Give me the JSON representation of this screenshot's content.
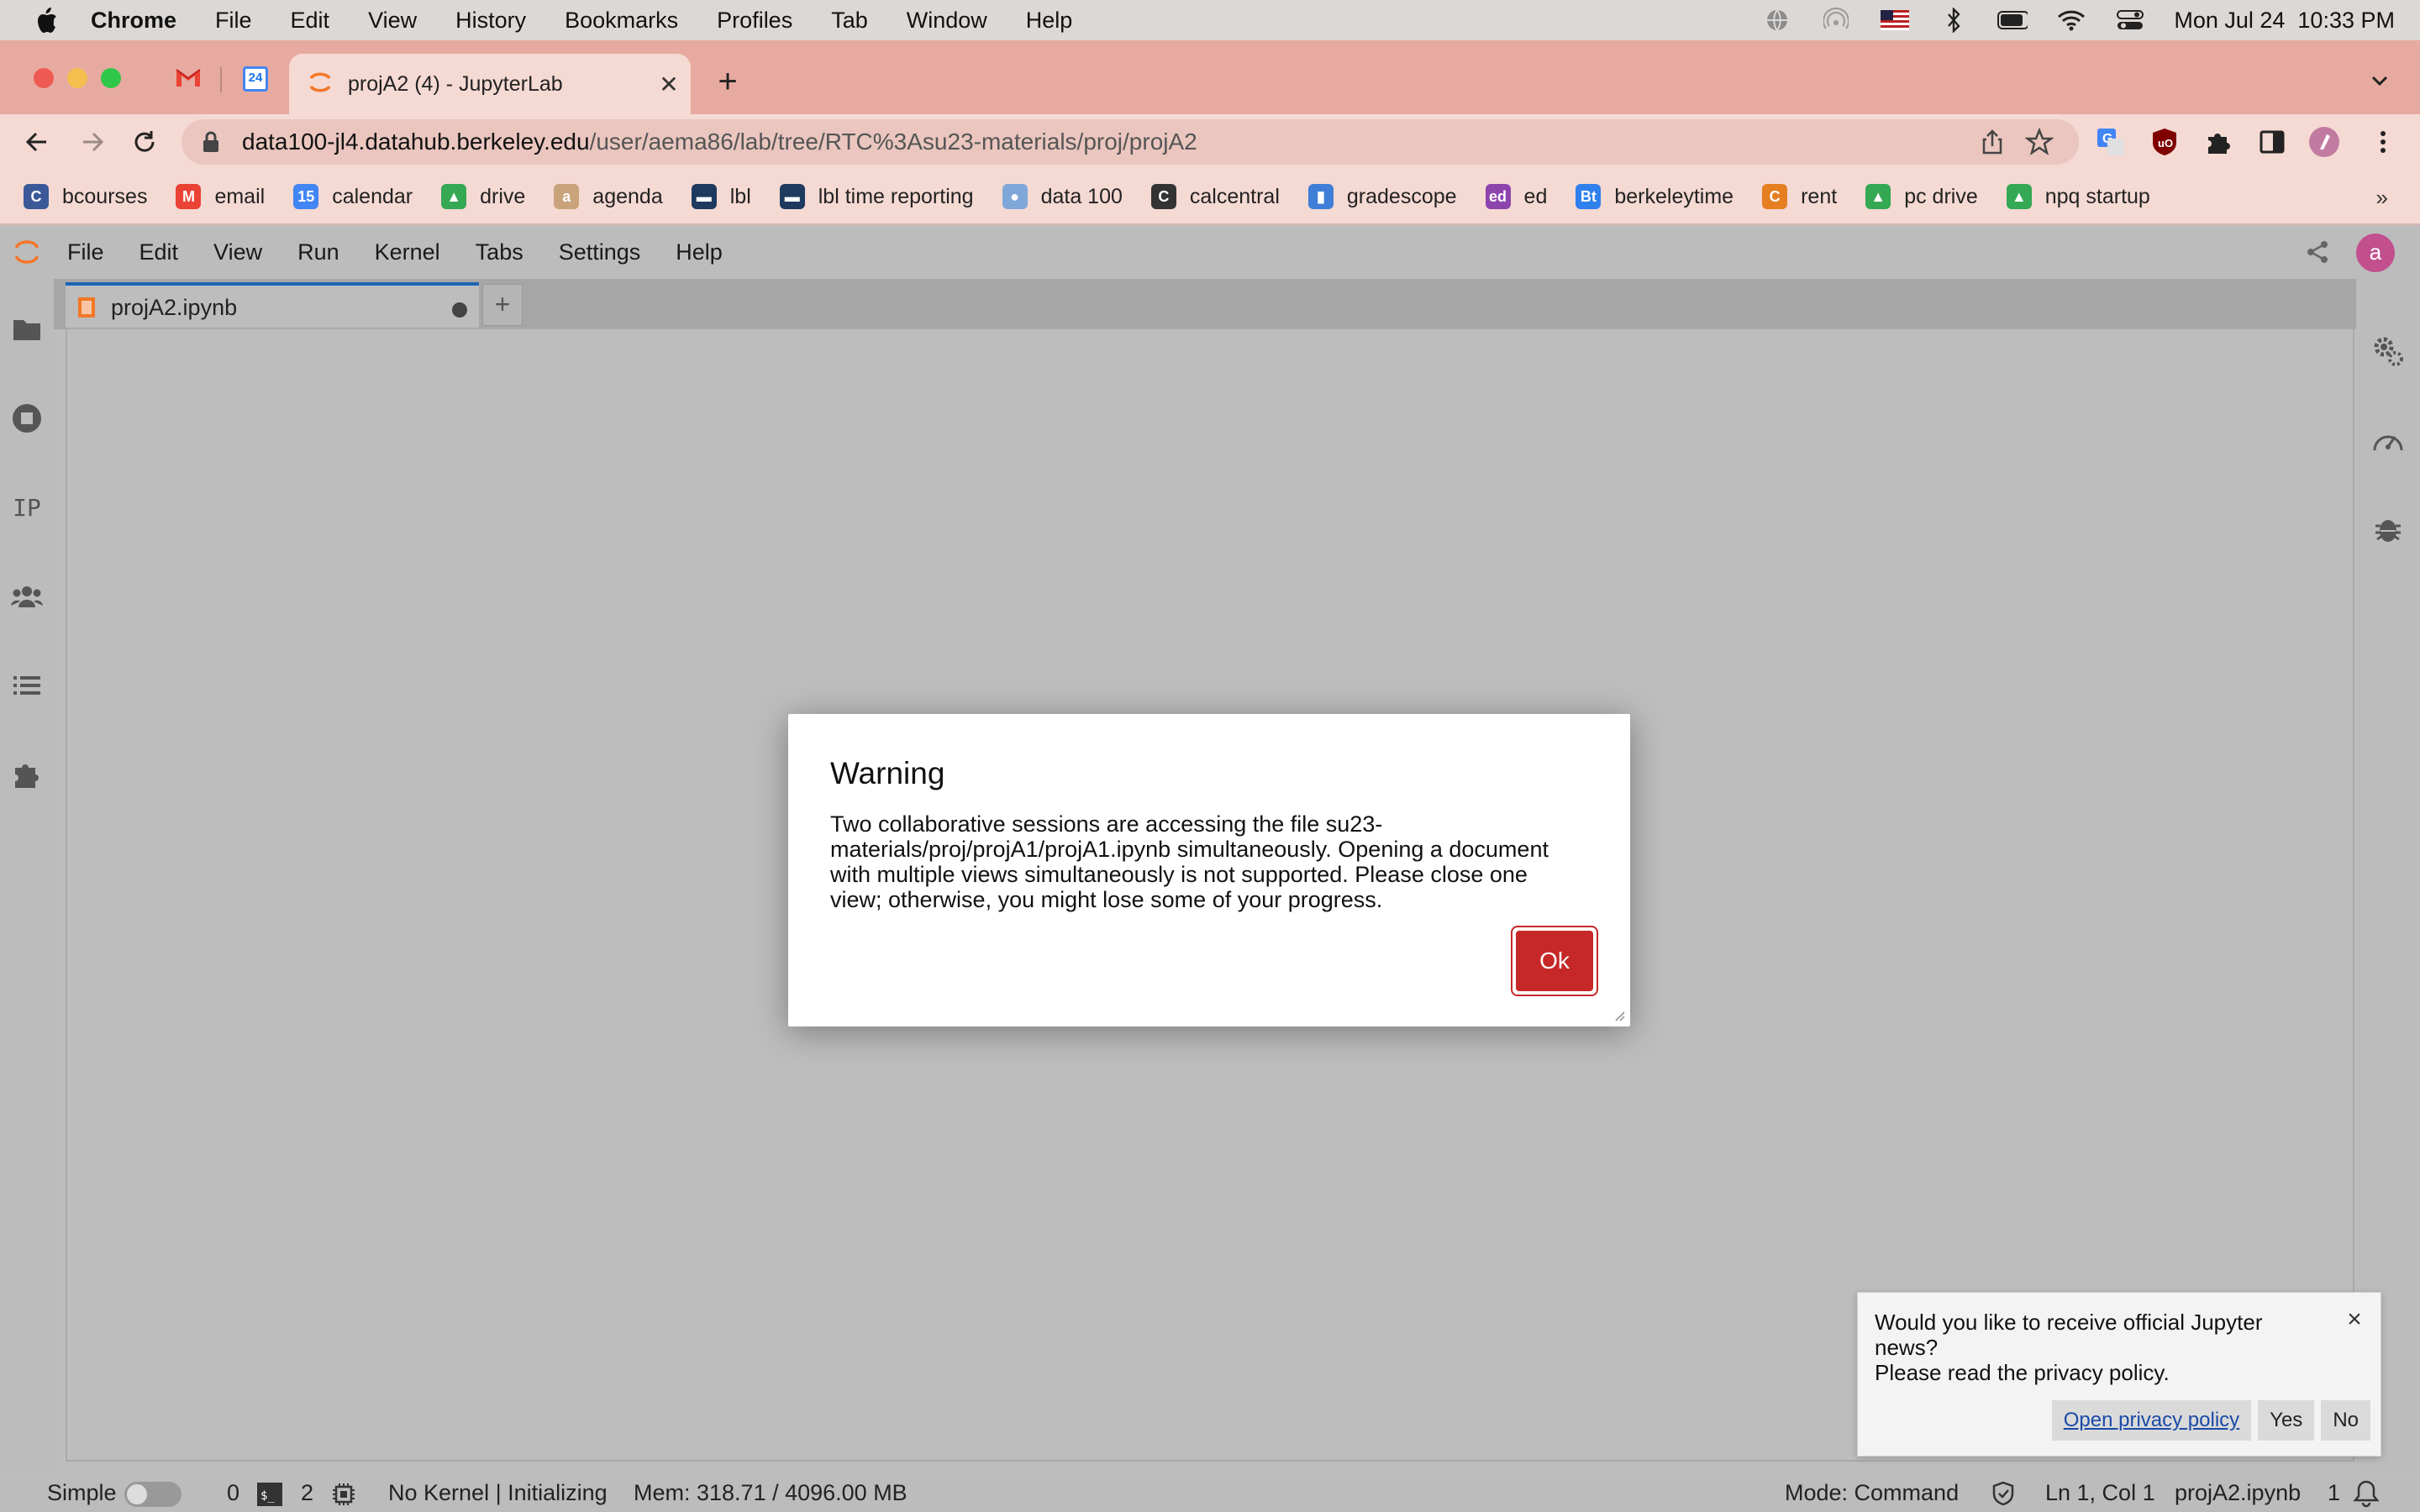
{
  "menubar": {
    "app": "Chrome",
    "items": [
      "File",
      "Edit",
      "View",
      "History",
      "Bookmarks",
      "Profiles",
      "Tab",
      "Window",
      "Help"
    ],
    "datetime": "Mon Jul 24  10:33 PM"
  },
  "browser": {
    "active_tab_title": "projA2 (4) - JupyterLab",
    "pinned_tabs": [
      {
        "icon": "gmail-icon",
        "badge": ""
      },
      {
        "icon": "calendar-icon",
        "badge": "24"
      }
    ],
    "url_host": "data100-jl4.datahub.berkeley.edu",
    "url_path": "/user/aema86/lab/tree/RTC%3Asu23-materials/proj/projA2",
    "bookmarks": [
      {
        "label": "bcourses",
        "icon": "canvas-icon",
        "color": "#3b5998",
        "glyph": "C"
      },
      {
        "label": "email",
        "icon": "gmail-icon",
        "color": "#ea4335",
        "glyph": "M"
      },
      {
        "label": "calendar",
        "icon": "calendar-icon",
        "color": "#4285f4",
        "glyph": "15"
      },
      {
        "label": "drive",
        "icon": "drive-icon",
        "color": "#34a853",
        "glyph": "▲"
      },
      {
        "label": "agenda",
        "icon": "agenda-icon",
        "color": "#c8a37b",
        "glyph": "a"
      },
      {
        "label": "lbl",
        "icon": "lbl-icon",
        "color": "#1f3a5f",
        "glyph": "▬"
      },
      {
        "label": "lbl time reporting",
        "icon": "lbl-icon",
        "color": "#1f3a5f",
        "glyph": "▬"
      },
      {
        "label": "data 100",
        "icon": "data100-icon",
        "color": "#7fa7d8",
        "glyph": "●"
      },
      {
        "label": "calcentral",
        "icon": "calcentral-icon",
        "color": "#333333",
        "glyph": "C"
      },
      {
        "label": "gradescope",
        "icon": "gradescope-icon",
        "color": "#3f7fd8",
        "glyph": "▮"
      },
      {
        "label": "ed",
        "icon": "ed-icon",
        "color": "#8e44ad",
        "glyph": "ed"
      },
      {
        "label": "berkeleytime",
        "icon": "berkeleytime-icon",
        "color": "#2f80ed",
        "glyph": "Bt"
      },
      {
        "label": "rent",
        "icon": "rent-icon",
        "color": "#e67e22",
        "glyph": "C"
      },
      {
        "label": "pc drive",
        "icon": "drive-icon",
        "color": "#34a853",
        "glyph": "▲"
      },
      {
        "label": "npq startup",
        "icon": "drive-icon",
        "color": "#34a853",
        "glyph": "▲"
      }
    ],
    "bookmarks_overflow": "»"
  },
  "jupyter": {
    "menu": [
      "File",
      "Edit",
      "View",
      "Run",
      "Kernel",
      "Tabs",
      "Settings",
      "Help"
    ],
    "user_initial": "a",
    "tab_label": "projA2.ipynb",
    "add_tab": "+",
    "left_sidebar_ip": "IP"
  },
  "dialog": {
    "title": "Warning",
    "body": "Two collaborative sessions are accessing the file su23-materials/proj/projA1/projA1.ipynb simultaneously. Opening a document with multiple views simultaneously is not supported. Please close one view; otherwise, you might lose some of your progress.",
    "ok_label": "Ok"
  },
  "toast": {
    "message_line1": "Would you like to receive official Jupyter news?",
    "message_line2": "Please read the privacy policy.",
    "close": "×",
    "privacy_link": "Open privacy policy",
    "yes": "Yes",
    "no": "No"
  },
  "statusbar": {
    "mode_label": "Simple",
    "terminals": "0",
    "kernels": "2",
    "kernel_status": "No Kernel | Initializing",
    "memory": "Mem: 318.71 / 4096.00 MB",
    "mode": "Mode: Command",
    "cursor": "Ln 1, Col 1",
    "file": "projA2.ipynb",
    "notifications": "1"
  },
  "colors": {
    "accent": "#c62828",
    "jupyter_orange": "#f37726",
    "tab_strip": "#e7aaa0",
    "toolbar": "#f5d9d3"
  }
}
